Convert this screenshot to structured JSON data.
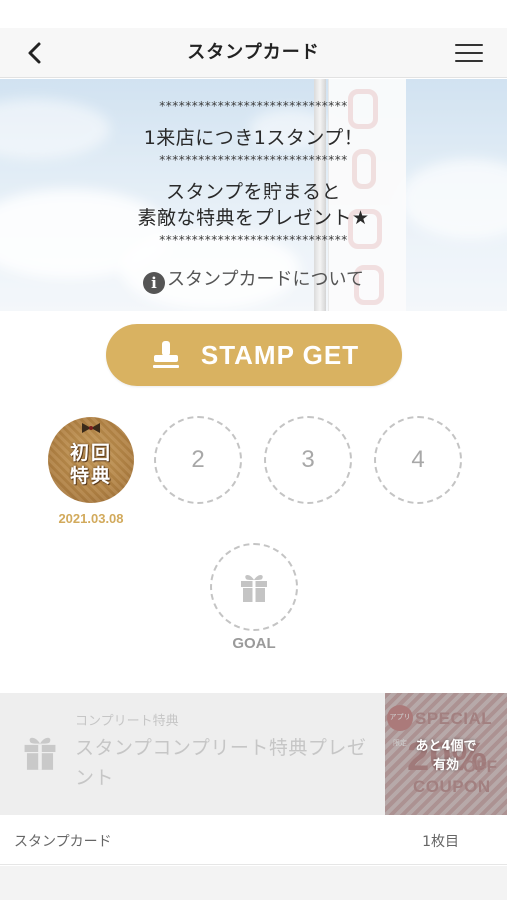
{
  "header": {
    "title": "スタンプカード",
    "back_icon": "chevron-left-icon",
    "menu_icon": "hamburger-menu-icon"
  },
  "banner": {
    "stars": "*****************************",
    "line1": "1来店につき1スタンプ！",
    "line2": "スタンプを貯まると",
    "line3": "素敵な特典をプレゼント★",
    "about_link": "スタンプカードについて",
    "about_icon": "info-icon"
  },
  "stamp_button": {
    "label": "STAMP GET",
    "icon": "stamp-icon",
    "color": "#d9b261"
  },
  "stamp_card": {
    "first_stamp": {
      "text_line1": "初回",
      "text_line2": "特典",
      "date": "2021.03.08"
    },
    "slots": [
      "2",
      "3",
      "4"
    ],
    "goal_label": "GOAL",
    "goal_icon": "gift-icon",
    "accent_color": "#d2aa5c"
  },
  "reward": {
    "small_label": "コンプリート特典",
    "title": "スタンプコンプリート特典プレゼント",
    "icon": "gift-icon",
    "coupon": {
      "tag": "アプリ限定",
      "special": "SPECIAL",
      "percent": "20%",
      "off": "OFF",
      "coupon_word": "COUPON",
      "remaining_line1": "あと4個で",
      "remaining_line2": "有効"
    }
  },
  "footer": {
    "left": "スタンプカード",
    "right": "1枚目"
  }
}
